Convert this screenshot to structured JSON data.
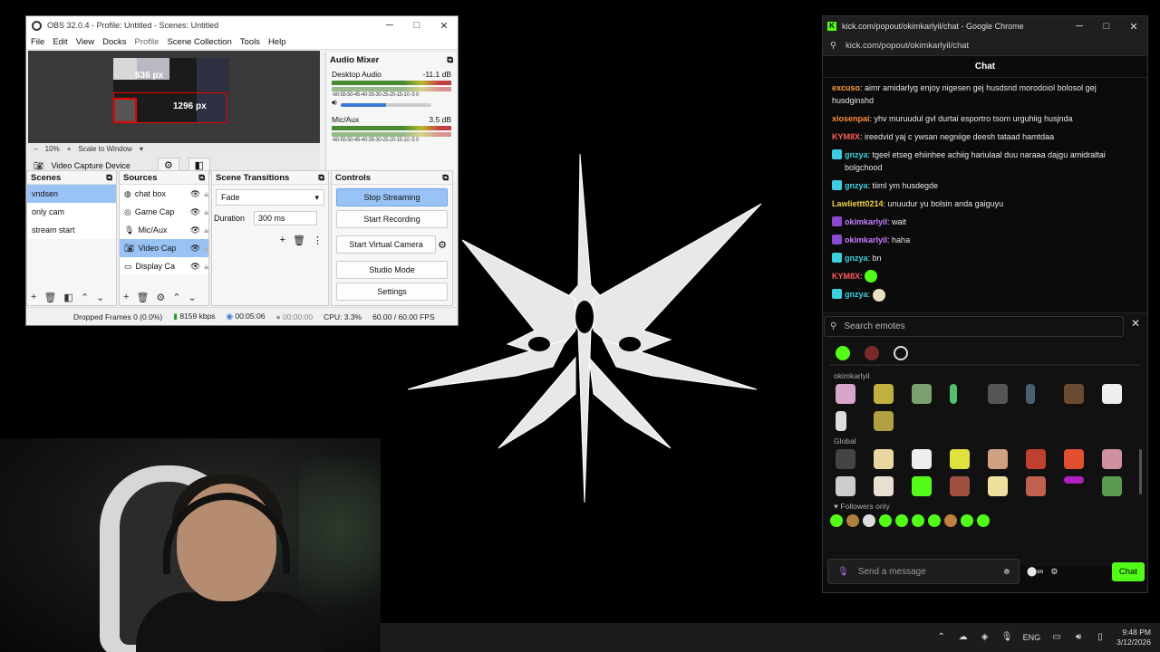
{
  "obs": {
    "title": "OBS 32.0.4 - Profile: Untitled - Scenes: Untitled",
    "menu": [
      "File",
      "Edit",
      "View",
      "Docks",
      "Profile",
      "Scene Collection",
      "Tools",
      "Help"
    ],
    "preview": {
      "label_height": "636 px",
      "label_width": "1296 px",
      "zoom": "10%",
      "scale_mode": "Scale to Window"
    },
    "source_toolbar": {
      "name": "Video Capture Device"
    },
    "mixer": {
      "title": "Audio Mixer",
      "channels": [
        {
          "name": "Desktop Audio",
          "db": "-11.1 dB"
        },
        {
          "name": "Mic/Aux",
          "db": "3.5 dB"
        }
      ],
      "scale": "-60-55-50-45-40-35-30-25-20-15-10 -5  0"
    },
    "scenes": {
      "title": "Scenes",
      "items": [
        "vndsen",
        "only cam",
        "stream start"
      ],
      "selected": 0
    },
    "sources": {
      "title": "Sources",
      "items": [
        "chat box",
        "Game Cap",
        "Mic/Aux",
        "Video Cap",
        "Display Ca"
      ],
      "selected": 3
    },
    "transitions": {
      "title": "Scene Transitions",
      "type": "Fade",
      "duration_label": "Duration",
      "duration": "300 ms"
    },
    "controls": {
      "title": "Controls",
      "stop_streaming": "Stop Streaming",
      "start_recording": "Start Recording",
      "start_virtual_camera": "Start Virtual Camera",
      "studio_mode": "Studio Mode",
      "settings": "Settings"
    },
    "status": {
      "dropped_frames": "Dropped Frames 0 (0.0%)",
      "bitrate": "8159 kbps",
      "stream_time": "00:05:06",
      "record_time": "00:00:00",
      "cpu": "CPU: 3.3%",
      "fps": "60.00 / 60.00 FPS"
    }
  },
  "chrome": {
    "title": "kick.com/popout/okimkarlyil/chat - Google Chrome",
    "address": "kick.com/popout/okimkarlyil/chat",
    "chat_title": "Chat",
    "messages": [
      {
        "user": "excuso",
        "color": "#ff9a3c",
        "text": "aimr amidarlyg enjoy nigesen gej husdsnd morodoiol bolosol gej husdginshd"
      },
      {
        "user": "xiosenpai",
        "color": "#ff8a3c",
        "text": "yhv muruudul gvl durtai esportro tsom urguhiig husjnda"
      },
      {
        "user": "KYM8X",
        "color": "#ff5a5a",
        "text": "ireedvid yaj c ywsan negniige deesh tataad hamtdaa"
      },
      {
        "user": "gnzya",
        "color": "#3ccfe0",
        "text": "tgeel etseg ehiinhee achiig hariulaal duu naraaa dajgu amidraltai bolgchood"
      },
      {
        "user": "gnzya",
        "color": "#3ccfe0",
        "text": "tiiml ym husdegde"
      },
      {
        "user": "Lawliettt0214",
        "color": "#f0d040",
        "text": "unuudur yu bolsin anda gaiguyu"
      },
      {
        "user": "okimkarlyil",
        "color": "#c77dff",
        "text": "wait"
      },
      {
        "user": "okimkarlyil",
        "color": "#c77dff",
        "text": "haha"
      },
      {
        "user": "gnzya",
        "color": "#3ccfe0",
        "text": "bn"
      },
      {
        "user": "KYM8X",
        "color": "#ff5a5a",
        "text": ""
      },
      {
        "user": "gnzya",
        "color": "#3ccfe0",
        "text": ""
      }
    ],
    "emote_search_placeholder": "Search emotes",
    "sections": {
      "channel": "okimkarlyil",
      "global": "Global",
      "followers": "Followers only"
    },
    "send_placeholder": "Send a message",
    "chat_button": "Chat"
  },
  "taskbar": {
    "language": "ENG",
    "time": "9:48 PM",
    "date": "3/12/2026"
  }
}
